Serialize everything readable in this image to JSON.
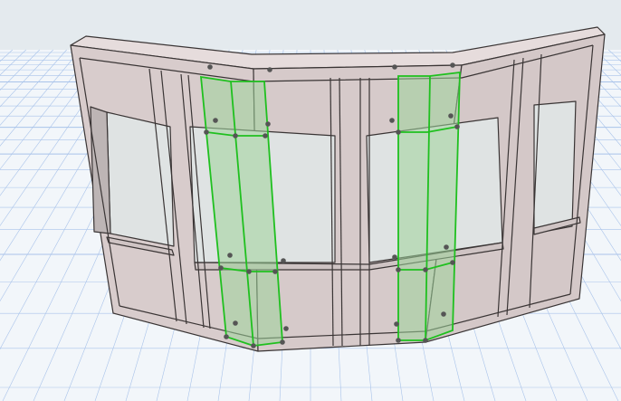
{
  "viewport": {
    "view": "3D",
    "colors": {
      "sky": "#e4eaee",
      "ground": "#f2f6fa",
      "grid": "#a9c3ea",
      "wall_face": "#d8cccc",
      "wall_top": "#e6dcdc",
      "wall_edge": "#3a3535",
      "glass": "#dfe3e3",
      "selection": "#1fc01f",
      "selection_fill": "#9fd49b",
      "hotspot": "#555555"
    },
    "icons": [
      "curtain-wall-model",
      "selection-hotspot"
    ]
  }
}
